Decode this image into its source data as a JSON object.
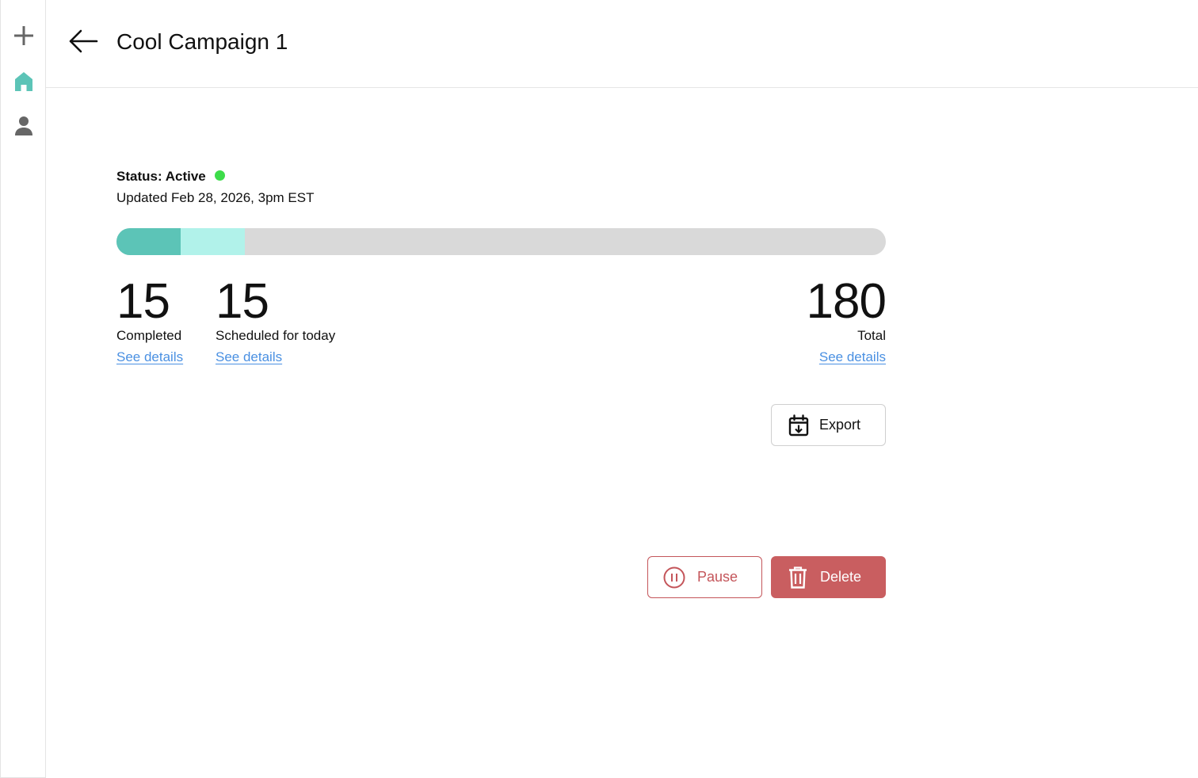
{
  "sidebar": {
    "items": [
      {
        "name": "add",
        "icon": "plus-icon"
      },
      {
        "name": "home",
        "icon": "home-icon",
        "active": true
      },
      {
        "name": "profile",
        "icon": "person-icon"
      }
    ]
  },
  "header": {
    "back_icon": "arrow-left-icon",
    "title": "Cool Campaign 1"
  },
  "status": {
    "label": "Status: Active",
    "indicator_color": "#3ddc4a",
    "updated": "Updated Feb 28, 2026, 3pm EST"
  },
  "progress": {
    "total": 180,
    "segments": [
      {
        "name": "completed",
        "value": 15,
        "color": "#5cc4b7"
      },
      {
        "name": "scheduled",
        "value": 15,
        "color": "#b1f2ea"
      }
    ],
    "track_color": "#d9d9d9"
  },
  "stats": {
    "completed": {
      "value": "15",
      "label": "Completed",
      "link": "See details"
    },
    "scheduled": {
      "value": "15",
      "label": "Scheduled for today",
      "link": "See details"
    },
    "total": {
      "value": "180",
      "label": "Total",
      "link": "See details"
    }
  },
  "actions": {
    "export": {
      "label": "Export",
      "icon": "calendar-download-icon"
    },
    "pause": {
      "label": "Pause",
      "icon": "pause-circle-icon",
      "color": "#c4555a"
    },
    "delete": {
      "label": "Delete",
      "icon": "trash-icon",
      "color": "#c95e60"
    }
  },
  "colors": {
    "accent": "#5cc4b7",
    "link": "#4a90e2",
    "danger": "#c95e60"
  }
}
